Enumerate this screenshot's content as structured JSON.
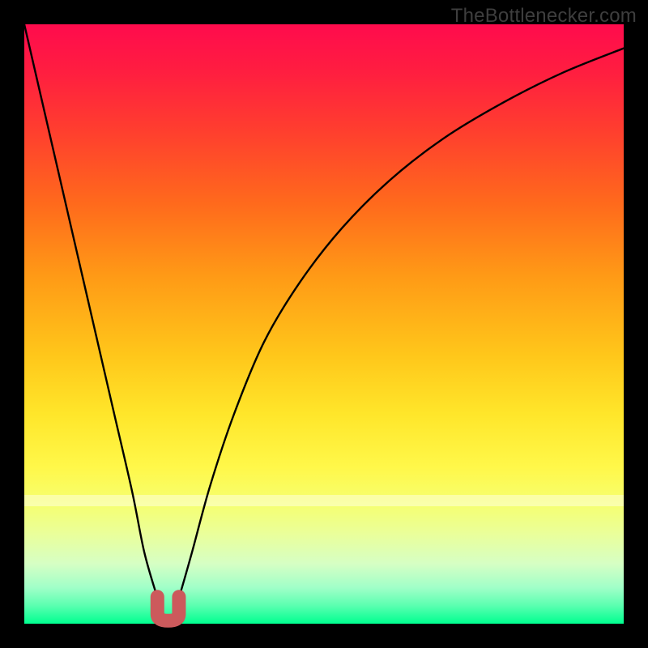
{
  "attribution": "TheBottlenecker.com",
  "chart_data": {
    "type": "line",
    "title": "",
    "xlabel": "",
    "ylabel": "",
    "xlim": [
      0,
      100
    ],
    "ylim": [
      0,
      100
    ],
    "series": [
      {
        "name": "bottleneck-curve",
        "x": [
          0,
          3,
          6,
          9,
          12,
          15,
          18,
          20,
          22,
          23,
          24,
          25,
          26,
          28,
          31,
          35,
          40,
          46,
          53,
          61,
          70,
          80,
          90,
          100
        ],
        "y": [
          100,
          87,
          74,
          61,
          48,
          35,
          22,
          12,
          5,
          2,
          1,
          2,
          5,
          12,
          23,
          35,
          47,
          57,
          66,
          74,
          81,
          87,
          92,
          96
        ]
      }
    ],
    "marker": {
      "name": "trough-u-marker",
      "color": "#cc5a5c",
      "x_range": [
        22.2,
        25.8
      ],
      "y_range": [
        0.5,
        4.5
      ]
    },
    "gradient_stops": [
      {
        "pos": 0,
        "color": "#ff0b4d"
      },
      {
        "pos": 18,
        "color": "#ff3f2e"
      },
      {
        "pos": 42,
        "color": "#ff9a16"
      },
      {
        "pos": 65,
        "color": "#ffe62a"
      },
      {
        "pos": 85,
        "color": "#eaff9a"
      },
      {
        "pos": 100,
        "color": "#00ff90"
      }
    ]
  }
}
